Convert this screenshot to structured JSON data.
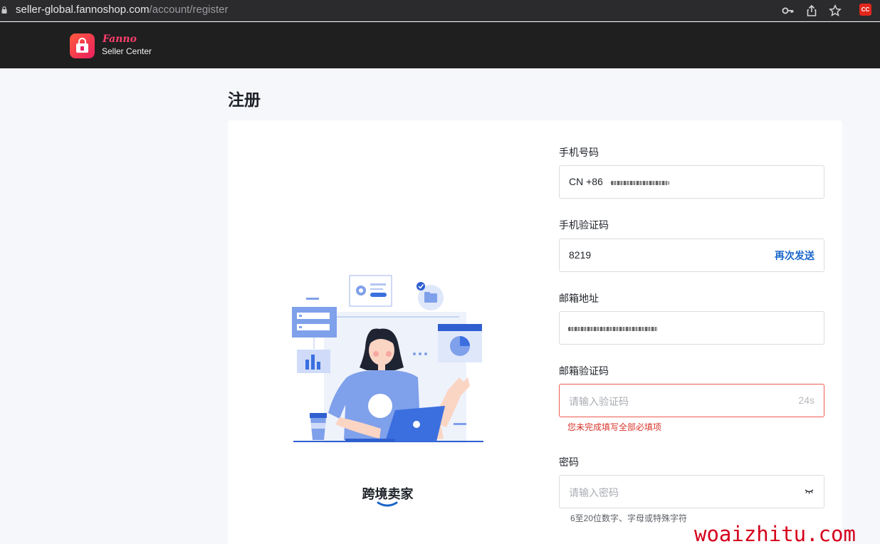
{
  "browser": {
    "url_domain": "seller-global.fannoshop.com",
    "url_path": "/account/register",
    "icons": [
      "lock-icon",
      "key-icon",
      "share-icon",
      "star-icon"
    ],
    "extension_badge": "CC"
  },
  "header": {
    "brand": "Fanno",
    "brand_sub": "Seller Center"
  },
  "page": {
    "title": "注册"
  },
  "illustration": {
    "caption": "跨境卖家"
  },
  "form": {
    "phone": {
      "label": "手机号码",
      "prefix": "CN +86"
    },
    "sms_code": {
      "label": "手机验证码",
      "value": "8219",
      "resend": "再次发送"
    },
    "email": {
      "label": "邮箱地址"
    },
    "email_code": {
      "label": "邮箱验证码",
      "placeholder": "请输入验证码",
      "countdown": "24s",
      "error": "您未完成填写全部必填项"
    },
    "password": {
      "label": "密码",
      "placeholder": "请输入密码",
      "hint": "6至20位数字、字母或特殊字符"
    }
  },
  "watermark": "woaizhitu.com",
  "colors": {
    "accent": "#1a66c9",
    "error": "#d9342b",
    "brand": "#ff3e6c"
  }
}
